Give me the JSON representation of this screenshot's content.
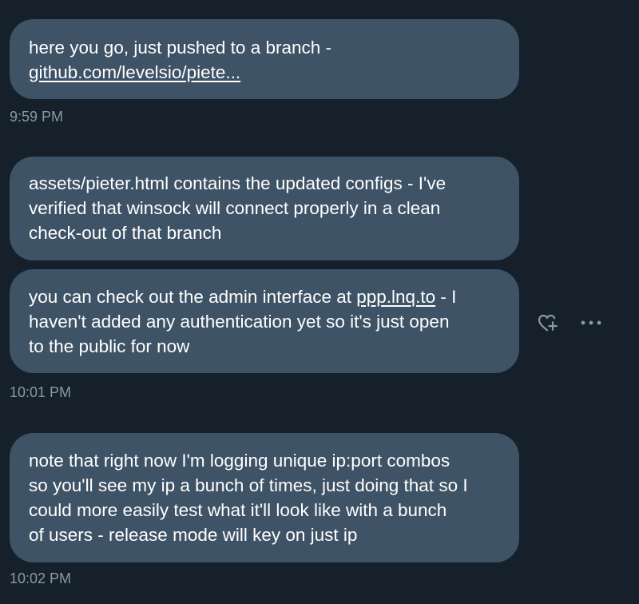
{
  "header": {
    "fragment": "· ·· ·····"
  },
  "messages": [
    {
      "lines": [
        "here you go, just pushed to a branch -"
      ],
      "link": "github.com/levelsio/piete...",
      "timestamp": "9:59 PM"
    },
    {
      "lines": [
        "assets/pieter.html contains the updated configs - I've",
        "verified that winsock will connect properly in a clean",
        "check-out of that branch"
      ]
    },
    {
      "line1_before": "you can check out the admin interface at ",
      "line1_link": "ppp.lnq.to",
      "line1_after": " - I",
      "lines": [
        "haven't added any authentication yet so it's just open",
        "to the public for now"
      ],
      "timestamp": "10:01 PM"
    },
    {
      "lines": [
        "note that right now I'm logging unique ip:port combos",
        "so you'll see my ip a bunch of times, just doing that so I",
        "could more easily test what it'll look like with a bunch",
        "of users - release mode will key on just ip"
      ],
      "timestamp": "10:02 PM"
    }
  ],
  "actions": {
    "react_icon": "heart-plus-icon",
    "more_icon": "more-horizontal-icon"
  },
  "colors": {
    "background": "#15202b",
    "bubble": "#3e5366",
    "timestamp": "#8b98a5",
    "text": "#ffffff"
  }
}
